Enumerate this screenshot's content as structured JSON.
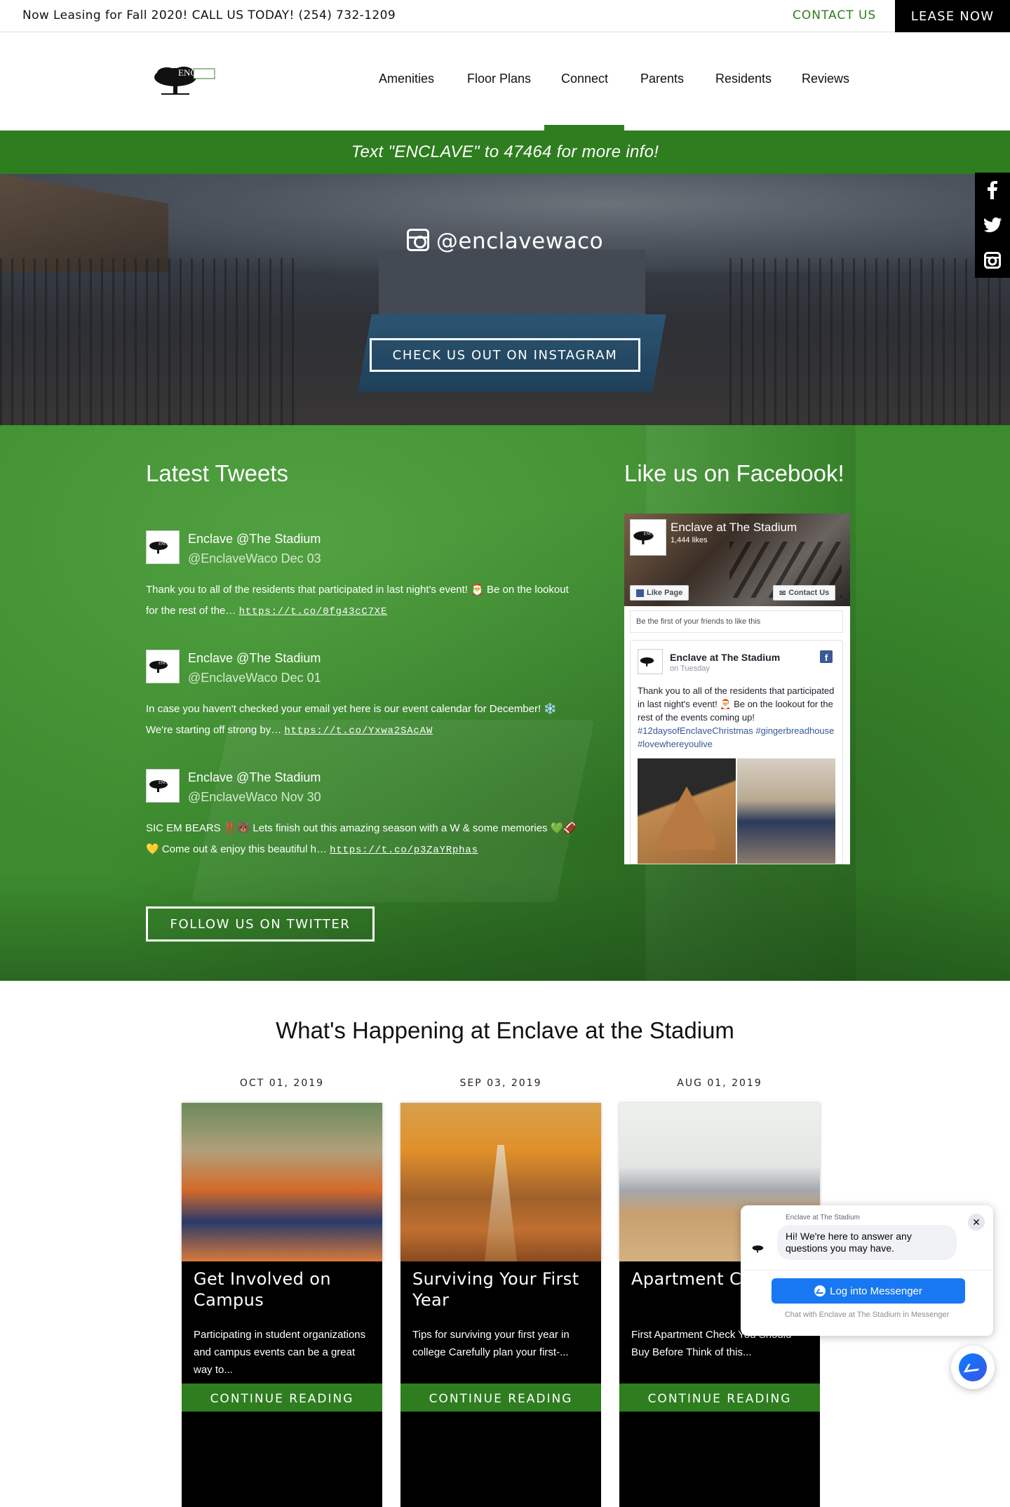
{
  "topbar": {
    "announcement": "Now Leasing for Fall 2020! CALL US TODAY! (254) 732-1209",
    "contact_label": "CONTACT US",
    "lease_label": "LEASE NOW"
  },
  "logo": {
    "text": "ENCLAVE"
  },
  "nav": {
    "items": [
      "Amenities",
      "Floor Plans",
      "Connect",
      "Parents",
      "Residents",
      "Reviews"
    ],
    "active": "Connect"
  },
  "text_banner": "Text \"ENCLAVE\" to 47464 for more info!",
  "hero": {
    "handle": "@enclavewaco",
    "button": "CHECK US OUT ON INSTAGRAM"
  },
  "social_bar": {
    "icons": [
      "facebook-icon",
      "twitter-icon",
      "instagram-icon"
    ]
  },
  "tweets_section": {
    "heading": "Latest Tweets",
    "tweets": [
      {
        "name": "Enclave @The Stadium",
        "handle_date": "@EnclaveWaco Dec 03",
        "text": "Thank you to all of the residents that participated in last night's event! 🎅 Be on the lookout for the rest of the…",
        "link": "https://t.co/0fg43cC7XE"
      },
      {
        "name": "Enclave @The Stadium",
        "handle_date": "@EnclaveWaco Dec 01",
        "text": "In case you haven't checked your email yet here is our event calendar for December! ❄️ We're starting off strong by…",
        "link": "https://t.co/Yxwa2SAcAW"
      },
      {
        "name": "Enclave @The Stadium",
        "handle_date": "@EnclaveWaco Nov 30",
        "text": "SIC EM BEARS ‼️🐻 Lets finish out this amazing season with a W & some memories 💚🏈 💛 Come out & enjoy this beautiful h…",
        "link": "https://t.co/p3ZaYRphas"
      }
    ],
    "follow_button": "FOLLOW US ON TWITTER"
  },
  "facebook_section": {
    "heading": "Like us on Facebook!",
    "page_name": "Enclave at The Stadium",
    "likes": "1,444 likes",
    "like_button": "Like Page",
    "contact_button": "Contact Us",
    "friends_text": "Be the first of your friends to like this",
    "post": {
      "author": "Enclave at The Stadium",
      "time": "on Tuesday",
      "text": "Thank you to all of the residents that participated in last night's event! 🎅 Be on the lookout for the rest of the events coming up!",
      "hashtags": "#12daysofEnclaveChristmas #gingerbreadhouse #lovewhereyoulive"
    }
  },
  "news": {
    "heading": "What's Happening at Enclave at the Stadium",
    "cards": [
      {
        "date": "OCT 01, 2019",
        "title": "Get Involved on Campus",
        "excerpt": "Participating in student organizations and campus events can be a great way to...",
        "more": "CONTINUE READING"
      },
      {
        "date": "SEP 03, 2019",
        "title": "Surviving Your First Year",
        "excerpt": "Tips for surviving your first year in college Carefully plan your first-...",
        "more": "CONTINUE READING"
      },
      {
        "date": "AUG 01, 2019",
        "title": "Apartment Ch",
        "excerpt": "First Apartment Check You Should Buy Before Think of this...",
        "more": "CONTINUE READING"
      }
    ]
  },
  "messenger": {
    "from": "Enclave at The Stadium",
    "message": "Hi! We're here to answer any questions you may have.",
    "login_button": "Log into Messenger",
    "subtext": "Chat with Enclave at The Stadium in Messenger",
    "close": "✕"
  }
}
